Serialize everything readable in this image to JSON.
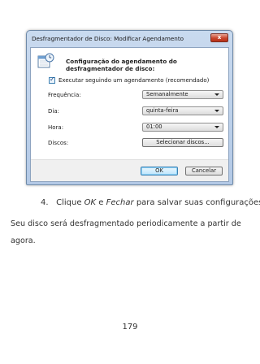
{
  "dialog": {
    "title": "Desfragmentador de Disco: Modificar Agendamento",
    "close_glyph": "x",
    "icon": "calendar-clock-icon",
    "heading": "Configuração do agendamento do desfragmentador de disco:",
    "checkbox_label": "Executar seguindo um agendamento (recomendado)",
    "checkbox_checked": true,
    "frequency_label": "Frequência:",
    "frequency_value": "Semanalmente",
    "day_label": "Dia:",
    "day_value": "quinta-feira",
    "time_label": "Hora:",
    "time_value": "01:00",
    "disks_label": "Discos:",
    "select_disks_button": "Selecionar discos...",
    "ok_button": "OK",
    "cancel_button": "Cancelar"
  },
  "document": {
    "step_number": "4.",
    "step_prefix": "Clique",
    "step_ok": "OK",
    "step_and": "e",
    "step_close": "Fechar",
    "step_suffix": "para salvar suas configurações",
    "paragraph": "Seu disco será desfragmentado periodicamente a partir de agora.",
    "page_number": "179"
  }
}
